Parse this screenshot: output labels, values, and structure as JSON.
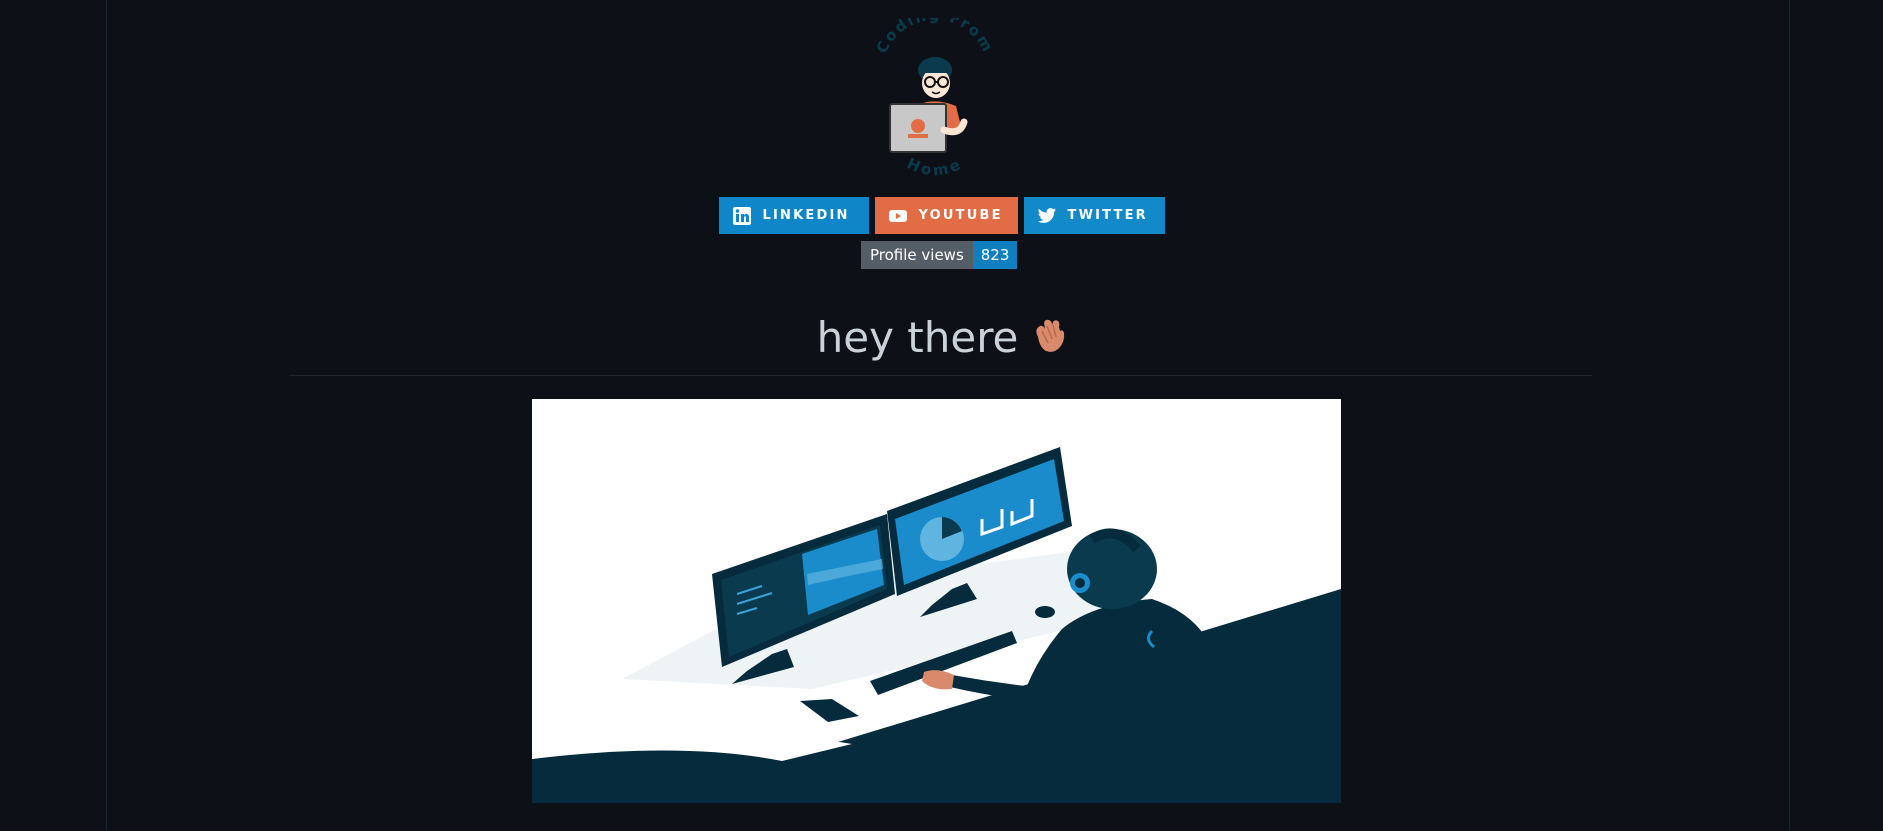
{
  "logo": {
    "top_text": "Coding From",
    "bottom_text": "Home",
    "icon": "coder-avatar-logo"
  },
  "badges": [
    {
      "label": "LINKEDIN",
      "icon": "linkedin-icon",
      "color": "#0e86c7"
    },
    {
      "label": "YOUTUBE",
      "icon": "youtube-icon",
      "color": "#e16c45"
    },
    {
      "label": "TWITTER",
      "icon": "twitter-icon",
      "color": "#1289c9"
    }
  ],
  "profile_views": {
    "label": "Profile views",
    "count": "823"
  },
  "greeting": {
    "text": "hey there",
    "emoji_icon": "waving-hand-icon"
  },
  "illustration": {
    "icon": "developer-at-dual-monitors-illustration"
  },
  "colors": {
    "background": "#0d1117",
    "heading": "#c9d1d9",
    "illustration_dark": "#062b3c",
    "illustration_accent": "#1a8ccc"
  }
}
